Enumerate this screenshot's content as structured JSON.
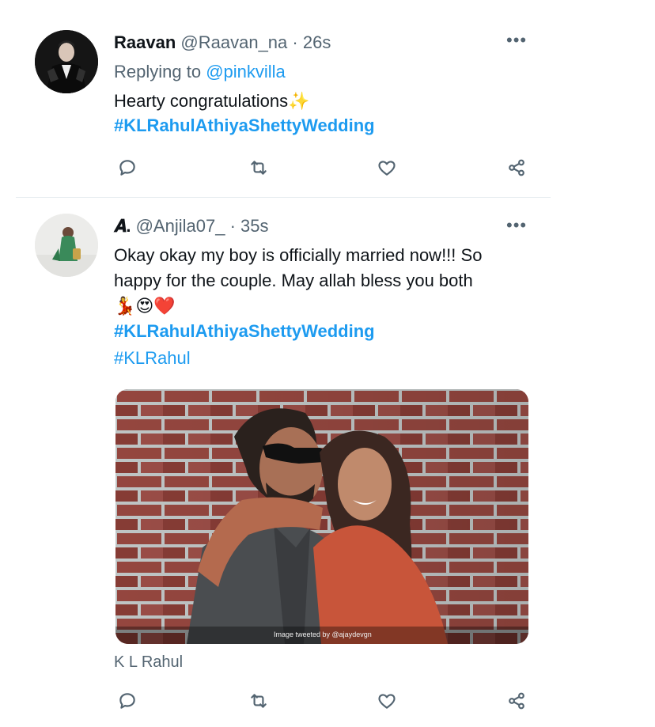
{
  "tweets": [
    {
      "display_name": "Raavan",
      "handle": "@Raavan_na",
      "separator": "·",
      "time": "26s",
      "replying_prefix": "Replying to",
      "replying_to": "@pinkvilla",
      "text": "Hearty congratulations✨",
      "hashtags": [
        "#KLRahulAthiyaShettyWedding"
      ]
    },
    {
      "display_name": "𝑨.",
      "handle": "@Anjila07_",
      "separator": "·",
      "time": "35s",
      "text_lines": [
        "Okay okay my boy is officially married now!!! So",
        "happy for the couple. May allah bless you both",
        "💃😍❤️"
      ],
      "hashtags": [
        "#KLRahulAthiyaShettyWedding",
        "#KLRahul"
      ],
      "media_credit": "Image tweeted by @ajaydevgn",
      "media_caption": "K L Rahul"
    }
  ],
  "more_label": "•••",
  "actions": [
    "reply-icon",
    "retweet-icon",
    "like-icon",
    "share-icon"
  ],
  "colors": {
    "link": "#1d9bf0",
    "secondary": "#536471",
    "text": "#0f1419"
  }
}
